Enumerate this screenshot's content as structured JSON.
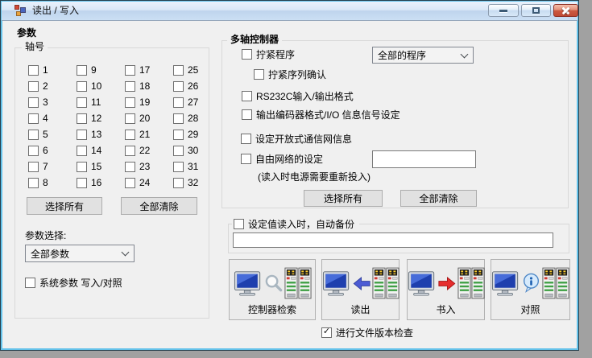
{
  "window": {
    "title": "读出 / 写入",
    "icon": "winforms-app-icon"
  },
  "left_panel": {
    "heading": "参数",
    "axis_group": {
      "caption": "轴号",
      "axes": [
        "1",
        "2",
        "3",
        "4",
        "5",
        "6",
        "7",
        "8",
        "9",
        "10",
        "11",
        "12",
        "13",
        "14",
        "15",
        "16",
        "17",
        "18",
        "19",
        "20",
        "21",
        "22",
        "23",
        "24",
        "25",
        "26",
        "27",
        "28",
        "29",
        "30",
        "31",
        "32"
      ],
      "select_all_label": "选择所有",
      "clear_all_label": "全部清除"
    },
    "param_select_label": "参数选择:",
    "param_select_value": "全部参数",
    "system_param_label": "系统参数 写入/对照"
  },
  "controller_panel": {
    "caption": "多轴控制器",
    "tighten_program_label": "拧紧程序",
    "program_select_value": "全部的程序",
    "sequence_confirm_label": "拧紧序列确认",
    "rs232c_label": "RS232C输入/输出格式",
    "encoder_label": "输出编码器格式/I/O 信息信号设定",
    "open_network_label": "设定开放式通信网信息",
    "free_network_label": "自由网络的设定",
    "free_network_value": "",
    "power_note": "(读入时电源需要重新投入)",
    "select_all_label": "选择所有",
    "clear_all_label": "全部清除"
  },
  "backup_group": {
    "caption": "设定值读入时，自动备份",
    "path_value": ""
  },
  "actions": {
    "buttons": [
      {
        "label": "控制器检索",
        "icon": "computer-magnifier-controllers-icon"
      },
      {
        "label": "读出",
        "icon": "computer-arrow-left-blue-controllers-icon"
      },
      {
        "label": "书入",
        "icon": "computer-arrow-right-red-controllers-icon"
      },
      {
        "label": "对照",
        "icon": "computer-info-controllers-icon"
      }
    ]
  },
  "footer": {
    "version_check_label": "进行文件版本检查",
    "version_check_checked": true
  },
  "colors": {
    "titlebar_top": "#eaf2fc",
    "titlebar_bottom": "#bfd4ed",
    "window_border_accent": "#64c2ea",
    "client_bg": "#f0f0f0",
    "close_button_red": "#cc5a42",
    "arrow_blue": "#4c5bd4",
    "arrow_red": "#e62d2d",
    "desktop_bg": "#a1a1a1"
  }
}
